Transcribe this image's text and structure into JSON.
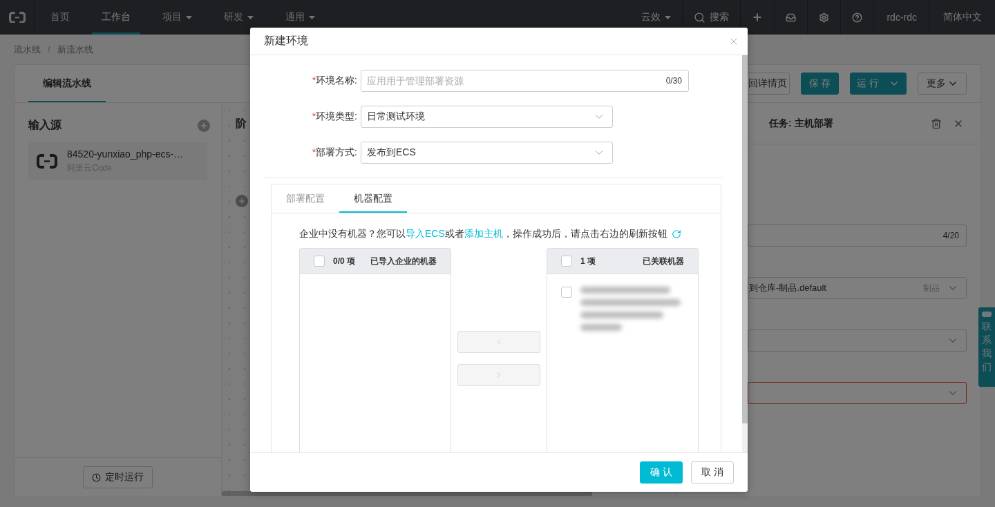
{
  "nav": {
    "items": [
      {
        "label": "首页",
        "selected": false,
        "dropdown": false
      },
      {
        "label": "工作台",
        "selected": true,
        "dropdown": false
      },
      {
        "label": "项目",
        "selected": false,
        "dropdown": true
      },
      {
        "label": "研发",
        "selected": false,
        "dropdown": true
      },
      {
        "label": "通用",
        "selected": false,
        "dropdown": true
      }
    ],
    "workspace": "云效",
    "search": "搜索",
    "user": "rdc-rdc",
    "language": "简体中文"
  },
  "breadcrumb": {
    "items": [
      "流水线",
      "新流水线"
    ],
    "separator": "/"
  },
  "editor": {
    "tabs": [
      {
        "label": "编辑流水线",
        "selected": true
      }
    ],
    "actions": [
      {
        "label": "回详情页",
        "kind": "default"
      },
      {
        "label": "保 存",
        "kind": "primary"
      },
      {
        "label": "运 行",
        "kind": "split"
      },
      {
        "label": "更多",
        "kind": "dropdown"
      }
    ]
  },
  "sources": {
    "title": "输入源",
    "items": [
      {
        "name": "84520-yunxiao_php-ecs-…",
        "provider": "阿里云Code"
      }
    ],
    "schedule_button": "定时运行"
  },
  "canvas": {
    "stage_title": "阶"
  },
  "task_panel": {
    "title": "任务: 主机部署",
    "fields": [
      {
        "kind": "input",
        "counter": "4/20",
        "error": false
      },
      {
        "kind": "select",
        "value": "到仓库-制品.default",
        "hint": "制品",
        "error": false
      },
      {
        "kind": "select",
        "error": false
      },
      {
        "kind": "select",
        "error": true
      }
    ]
  },
  "contact_tab": {
    "label": "联系我们"
  },
  "dialog": {
    "title": "新建环境",
    "required_mark": "*",
    "fields": [
      {
        "label": "环境名称:",
        "required": true,
        "kind": "input",
        "placeholder": "应用用于管理部署资源",
        "counter": "0/30"
      },
      {
        "label": "环境类型:",
        "required": true,
        "kind": "select",
        "value": "日常测试环境"
      },
      {
        "label": "部署方式:",
        "required": true,
        "kind": "select",
        "value": "发布到ECS"
      }
    ],
    "tabs": [
      {
        "label": "部署配置",
        "selected": false
      },
      {
        "label": "机器配置",
        "selected": true
      }
    ],
    "notice": [
      {
        "kind": "text",
        "text": "企业中没有机器？您可以"
      },
      {
        "kind": "link",
        "text": "导入ECS"
      },
      {
        "kind": "text",
        "text": "或者"
      },
      {
        "kind": "link",
        "text": "添加主机"
      },
      {
        "kind": "text",
        "text": "，操作成功后，请点击右边的刷新按钮"
      }
    ],
    "transfer": {
      "source": {
        "count": "0/0 项",
        "title": "已导入企业的机器",
        "checked": false
      },
      "target": {
        "count": "1 项",
        "title": "已关联机器",
        "checked": false,
        "items": [
          {
            "checked": false
          }
        ]
      },
      "buttons": [
        {
          "kind": "move-left",
          "disabled": true
        },
        {
          "kind": "move-right",
          "disabled": true
        }
      ]
    },
    "footer": [
      {
        "label": "确 认",
        "kind": "primary"
      },
      {
        "label": "取 消",
        "kind": "default"
      }
    ]
  }
}
